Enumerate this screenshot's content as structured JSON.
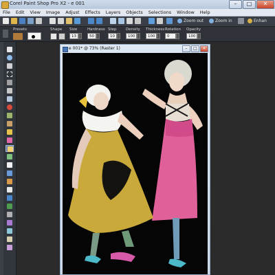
{
  "window": {
    "title": "Corel Paint Shop Pro X2 - e 001",
    "minimize": "–",
    "maximize": "□",
    "close": "✕"
  },
  "menubar": {
    "items": [
      "File",
      "Edit",
      "View",
      "Image",
      "Adjust",
      "Effects",
      "Layers",
      "Objects",
      "Selections",
      "Window",
      "Help"
    ]
  },
  "toolbar": {
    "zoom_out_label": "Zoom out",
    "zoom_in_label": "Zoom in",
    "enhance_label": "Enhan"
  },
  "options": {
    "presets_label": "Presets",
    "shape_label": "Shape",
    "size_label": "Size",
    "size_value": "13",
    "hardness_label": "Hardness",
    "hardness_value": "50",
    "step_label": "Step",
    "step_value": "10",
    "density_label": "Density",
    "density_value": "100",
    "thickness_label": "Thickness",
    "thickness_value": "100",
    "rotation_label": "Rotation",
    "rotation_value": "0",
    "opacity_label": "Opacity",
    "opacity_value": "100"
  },
  "document": {
    "title": "e 001* @ 73% (Raster 1)"
  },
  "colors": {
    "titlebar": "#c3d3e6",
    "toolbar": "#3a3f47",
    "workspace": "#2b2b2b",
    "canvas": "#050505",
    "dress_left": "#c9a93a",
    "dress_right": "#e0609a"
  }
}
